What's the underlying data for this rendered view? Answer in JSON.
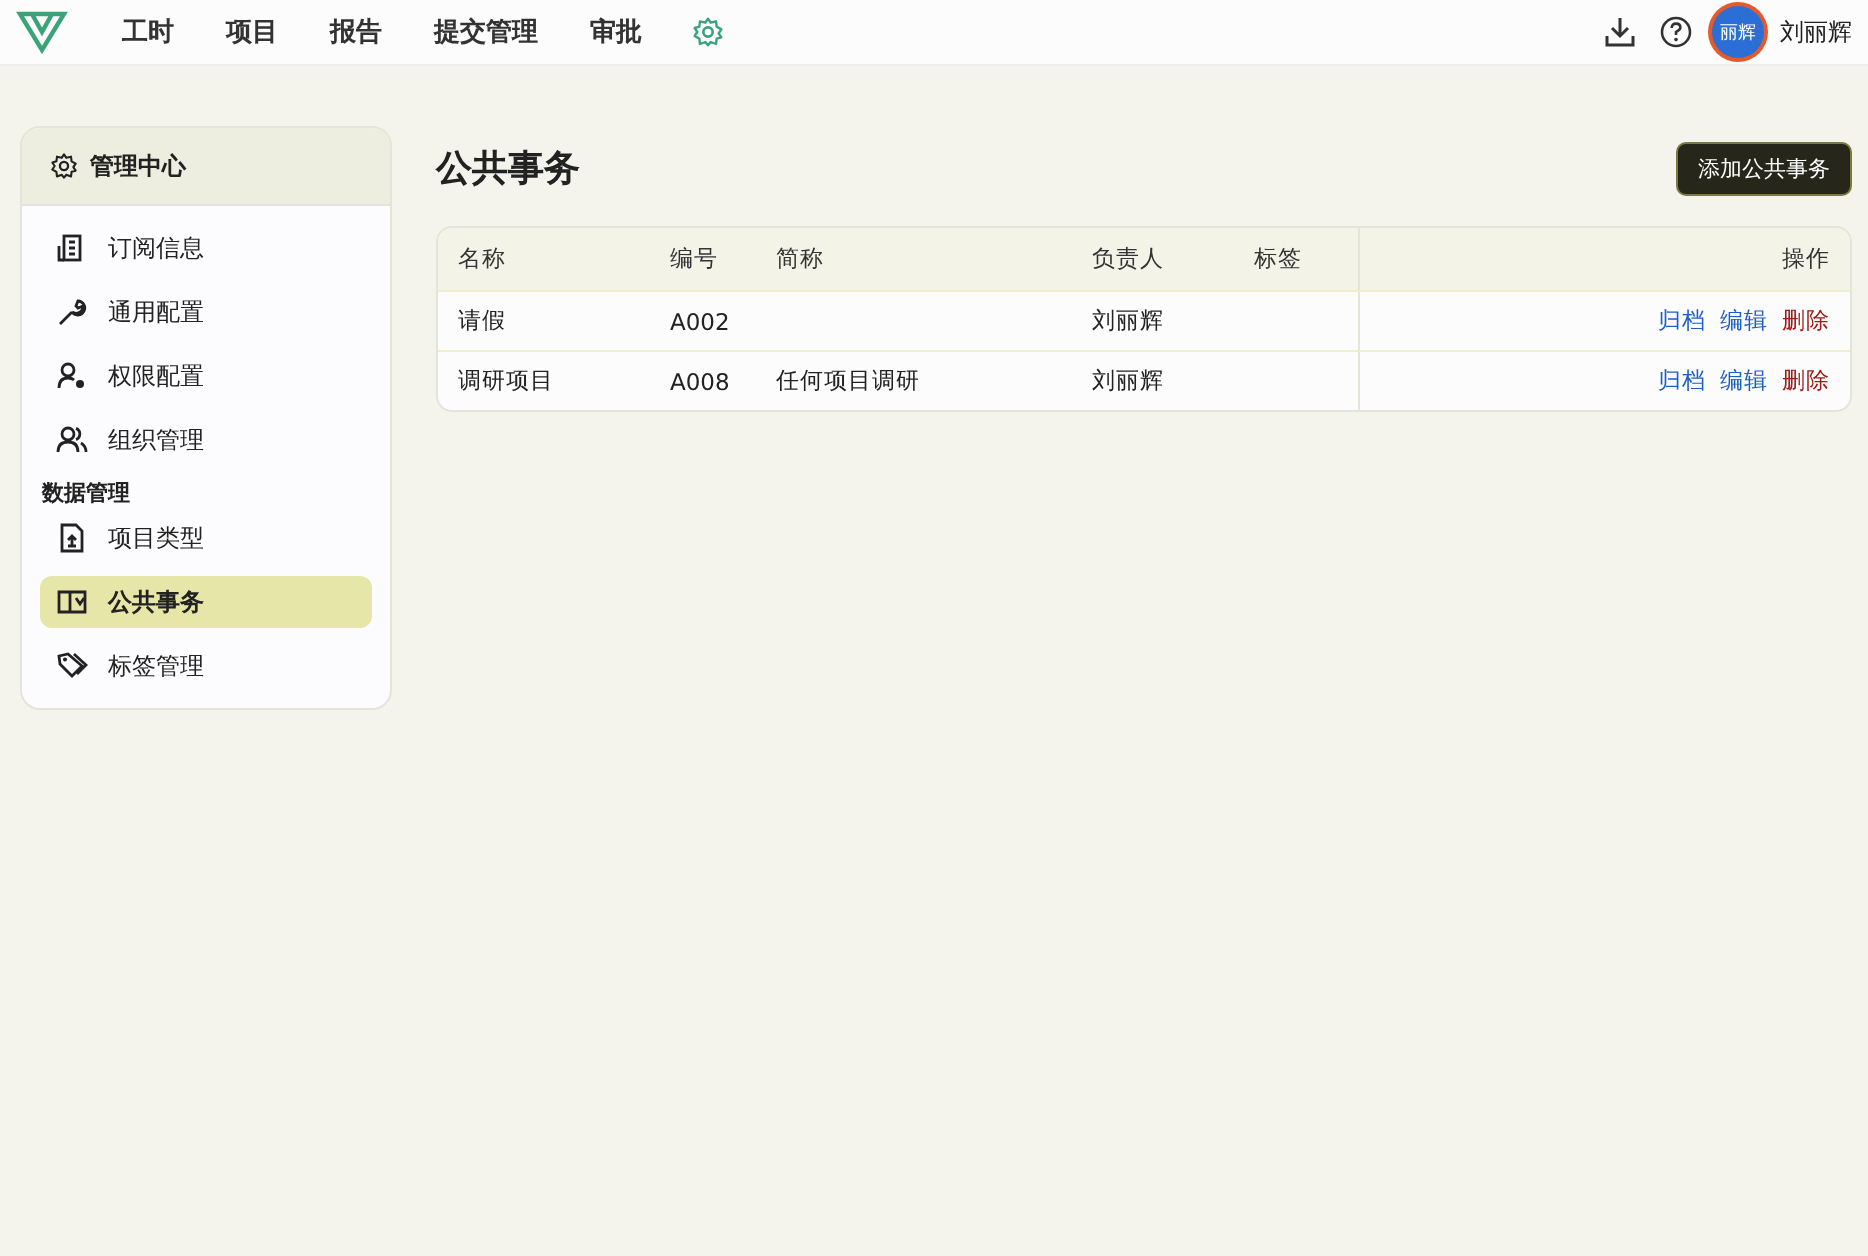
{
  "nav": {
    "items": [
      {
        "label": "工时",
        "selected": false
      },
      {
        "label": "项目",
        "selected": false
      },
      {
        "label": "报告",
        "selected": false
      },
      {
        "label": "提交管理",
        "selected": false
      },
      {
        "label": "审批",
        "selected": false
      }
    ]
  },
  "user": {
    "avatar_text": "丽辉",
    "name": "刘丽辉"
  },
  "sidebar": {
    "title": "管理中心",
    "items": [
      {
        "kind": "link",
        "label": "订阅信息",
        "selected": false
      },
      {
        "kind": "link",
        "label": "通用配置",
        "selected": false
      },
      {
        "kind": "link",
        "label": "权限配置",
        "selected": false
      },
      {
        "kind": "link",
        "label": "组织管理",
        "selected": false
      },
      {
        "kind": "heading",
        "label": "数据管理"
      },
      {
        "kind": "link",
        "label": "项目类型",
        "selected": false
      },
      {
        "kind": "link",
        "label": "公共事务",
        "selected": true
      },
      {
        "kind": "link",
        "label": "标签管理",
        "selected": false
      }
    ]
  },
  "page": {
    "title": "公共事务",
    "add_button": "添加公共事务"
  },
  "table": {
    "columns": [
      "名称",
      "编号",
      "简称",
      "负责人",
      "标签",
      "操作"
    ],
    "rows": [
      {
        "cells": [
          "请假",
          "A002",
          "",
          "刘丽辉",
          ""
        ],
        "actions": [
          {
            "kind": "normal",
            "label": "归档"
          },
          {
            "kind": "normal",
            "label": "编辑"
          },
          {
            "kind": "danger",
            "label": "删除"
          }
        ]
      },
      {
        "cells": [
          "调研项目",
          "A008",
          "任何项目调研",
          "刘丽辉",
          ""
        ],
        "actions": [
          {
            "kind": "normal",
            "label": "归档"
          },
          {
            "kind": "normal",
            "label": "编辑"
          },
          {
            "kind": "danger",
            "label": "删除"
          }
        ]
      }
    ]
  }
}
